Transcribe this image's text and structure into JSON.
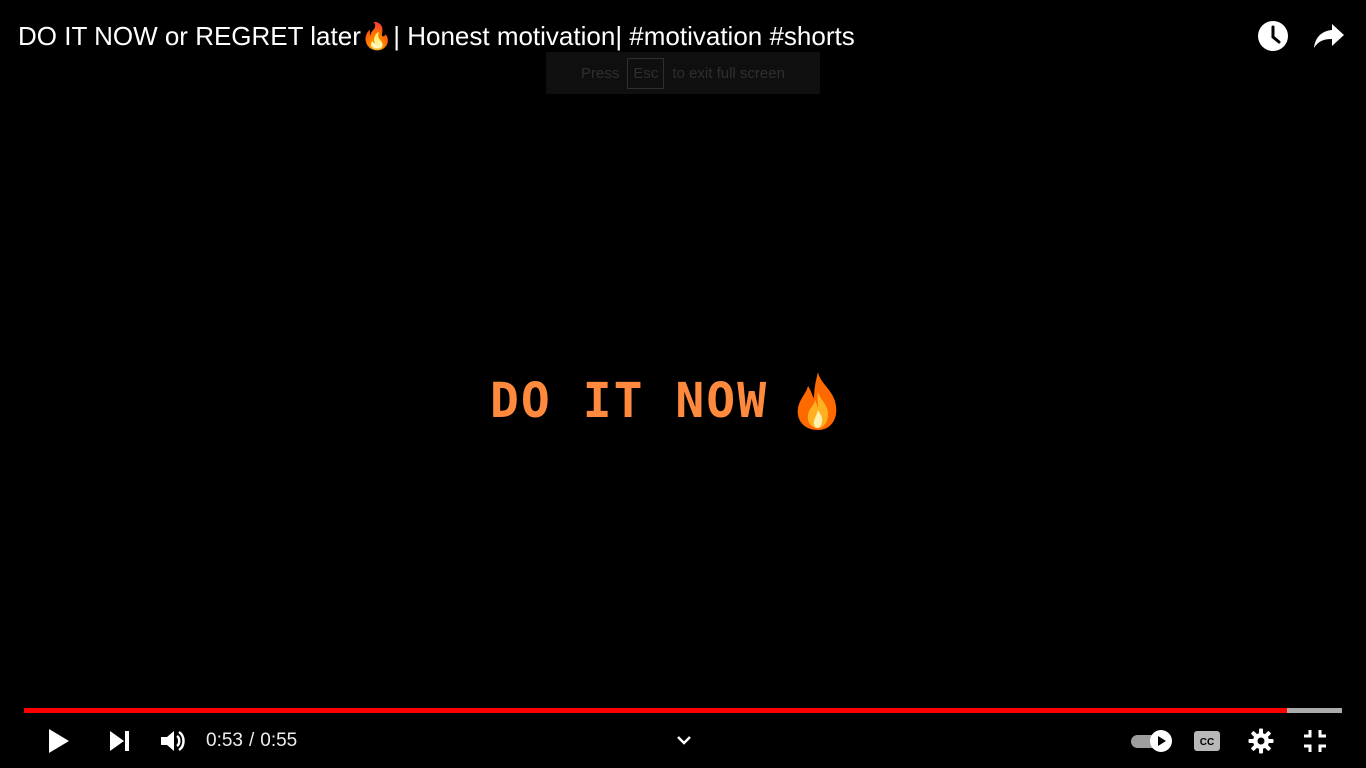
{
  "header": {
    "title": "DO IT NOW or REGRET later🔥| Honest motivation| #motivation #shorts",
    "watch_later_icon": "clock-icon",
    "share_icon": "share-arrow-icon"
  },
  "fullscreen_hint": {
    "prefix": "Press",
    "key": "Esc",
    "suffix": "to exit full screen"
  },
  "video": {
    "caption_text": "DO IT NOW",
    "caption_emoji": "🔥",
    "caption_color": "#ff8a3d"
  },
  "progress": {
    "played_fraction": 0.958,
    "buffered_fraction": 1.0,
    "played_color": "#ff0000"
  },
  "controls": {
    "current_time": "0:53",
    "separator": "/",
    "duration": "0:55",
    "icons": {
      "play": "play-icon",
      "next": "next-icon",
      "volume": "volume-icon",
      "expand": "chevron-down-icon",
      "autoplay": "autoplay-toggle-icon",
      "captions": "closed-captions-icon",
      "settings": "gear-icon",
      "exit_fullscreen": "exit-fullscreen-icon"
    }
  }
}
